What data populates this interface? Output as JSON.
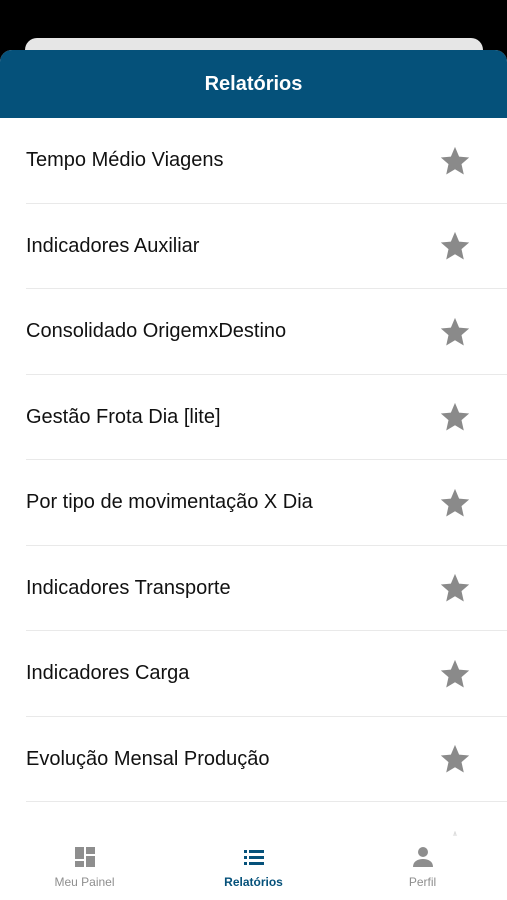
{
  "header": {
    "title": "Relatórios"
  },
  "reports": [
    {
      "label": "Tempo Médio Viagens",
      "icon": "star-icon"
    },
    {
      "label": "Indicadores Auxiliar",
      "icon": "star-icon"
    },
    {
      "label": "Consolidado OrigemxDestino",
      "icon": "star-icon"
    },
    {
      "label": "Gestão Frota Dia [lite]",
      "icon": "star-icon"
    },
    {
      "label": "Por tipo de movimentação X Dia",
      "icon": "star-icon"
    },
    {
      "label": "Indicadores Transporte",
      "icon": "star-icon"
    },
    {
      "label": "Indicadores Carga",
      "icon": "star-icon"
    },
    {
      "label": "Evolução Mensal Produção",
      "icon": "star-icon"
    },
    {
      "label": "",
      "icon": "star-icon"
    }
  ],
  "tabbar": {
    "tabs": [
      {
        "label": "Meu Painel",
        "icon": "dashboard-icon",
        "active": false
      },
      {
        "label": "Relatórios",
        "icon": "list-icon",
        "active": true
      },
      {
        "label": "Perfil",
        "icon": "person-icon",
        "active": false
      }
    ]
  },
  "colors": {
    "header_bg": "#05517a",
    "accent": "#05517a",
    "star": "#8a8a8a",
    "inactive_tab": "#8e8e8e"
  }
}
